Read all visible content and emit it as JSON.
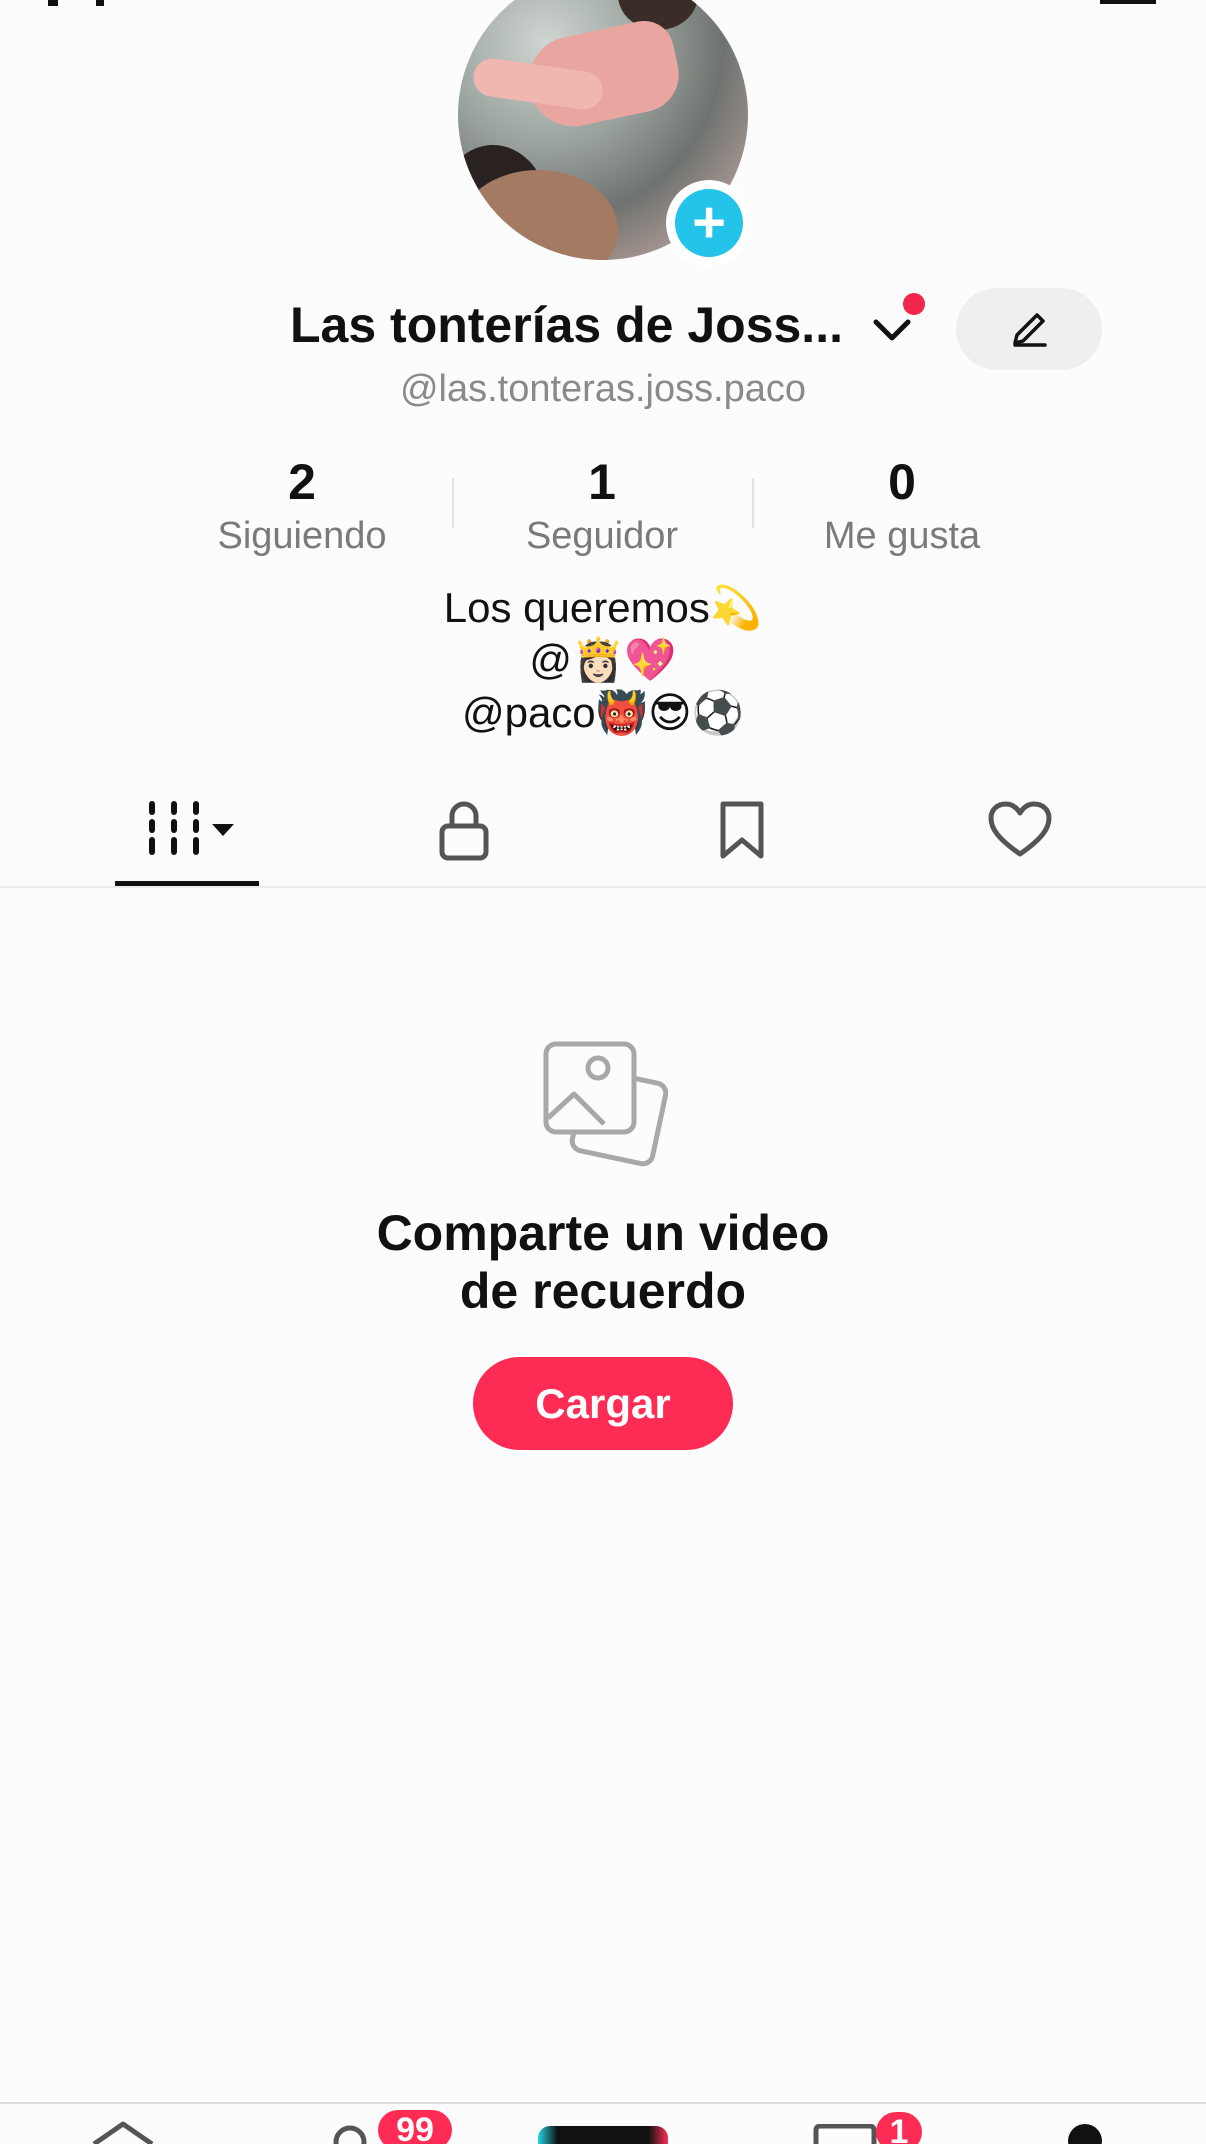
{
  "profile": {
    "display_name": "Las tonterías de Joss...",
    "handle": "@las.tonteras.joss.paco",
    "stats": [
      {
        "value": "2",
        "label": "Siguiendo"
      },
      {
        "value": "1",
        "label": "Seguidor"
      },
      {
        "value": "0",
        "label": "Me gusta"
      }
    ],
    "bio_lines": [
      "Los queremos💫",
      "@👸🏻💖",
      "@paco👹😎⚽"
    ]
  },
  "tabs": [
    {
      "name": "videos",
      "icon": "grid-icon",
      "active": true
    },
    {
      "name": "private",
      "icon": "lock-icon",
      "active": false
    },
    {
      "name": "saved",
      "icon": "bookmark-icon",
      "active": false
    },
    {
      "name": "liked",
      "icon": "heart-icon",
      "active": false
    }
  ],
  "empty_state": {
    "icon": "photo-stack-icon",
    "title_line1": "Comparte un video",
    "title_line2": "de recuerdo",
    "button_label": "Cargar"
  },
  "bottom_nav": {
    "friends_badge": "99",
    "inbox_badge": "1"
  },
  "colors": {
    "accent": "#fe2c55",
    "add_badge": "#23c3ea",
    "handle_gray": "#8a8a8a"
  }
}
